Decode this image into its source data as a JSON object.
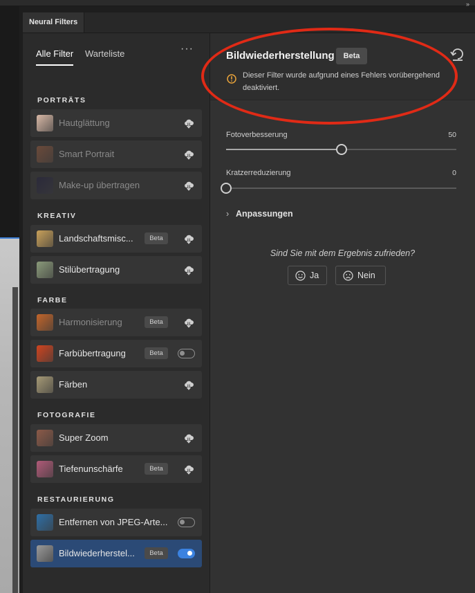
{
  "window": {
    "collapse_label": "»"
  },
  "panel": {
    "tab_label": "Neural Filters"
  },
  "filter_tabs": {
    "all": "Alle Filter",
    "waitlist": "Warteliste",
    "more": "···"
  },
  "sections": [
    {
      "title": "PORTRÄTS",
      "items": [
        {
          "label": "Hautglättung",
          "enabled": false,
          "beta": "",
          "action": "download",
          "thumb": "#d8b8a6"
        },
        {
          "label": "Smart Portrait",
          "enabled": false,
          "beta": "",
          "action": "download",
          "thumb": "#6a4a3a"
        },
        {
          "label": "Make-up übertragen",
          "enabled": false,
          "beta": "",
          "action": "download",
          "thumb": "#2b2a3a"
        }
      ]
    },
    {
      "title": "KREATIV",
      "items": [
        {
          "label": "Landschaftsmisc...",
          "enabled": true,
          "beta": "Beta",
          "action": "download",
          "thumb": "#c9a15a"
        },
        {
          "label": "Stilübertragung",
          "enabled": true,
          "beta": "",
          "action": "download",
          "thumb": "#8a9a7a"
        }
      ]
    },
    {
      "title": "FARBE",
      "items": [
        {
          "label": "Harmonisierung",
          "enabled": false,
          "beta": "Beta",
          "action": "download",
          "thumb": "#c2652a"
        },
        {
          "label": "Farbübertragung",
          "enabled": true,
          "beta": "Beta",
          "action": "toggle-off",
          "thumb": "#d0441f"
        },
        {
          "label": "Färben",
          "enabled": true,
          "beta": "",
          "action": "download",
          "thumb": "#a69a76"
        }
      ]
    },
    {
      "title": "FOTOGRAFIE",
      "items": [
        {
          "label": "Super Zoom",
          "enabled": true,
          "beta": "",
          "action": "download",
          "thumb": "#8c5a48"
        },
        {
          "label": "Tiefenunschärfe",
          "enabled": true,
          "beta": "Beta",
          "action": "download",
          "thumb": "#b05a78"
        }
      ]
    },
    {
      "title": "RESTAURIERUNG",
      "items": [
        {
          "label": "Entfernen von JPEG-Arte...",
          "enabled": true,
          "beta": "",
          "action": "toggle-off",
          "thumb": "#2e6fa6"
        },
        {
          "label": "Bildwiederherstel...",
          "enabled": true,
          "beta": "Beta",
          "action": "toggle-on",
          "thumb": "#9a9a9a",
          "selected": true
        }
      ]
    }
  ],
  "detail": {
    "title": "Bildwiederherstellung",
    "beta": "Beta",
    "warning": "Dieser Filter wurde aufgrund eines Fehlers vorübergehend deaktiviert.",
    "sliders": [
      {
        "label": "Fotoverbesserung",
        "value": 50,
        "min": 0,
        "max": 100
      },
      {
        "label": "Kratzerreduzierung",
        "value": 0,
        "min": 0,
        "max": 100
      }
    ],
    "adjustments_label": "Anpassungen",
    "feedback_question": "Sind Sie mit dem Ergebnis zufrieden?",
    "yes_label": "Ja",
    "no_label": "Nein"
  },
  "colors": {
    "accent_blue": "#3b82e0",
    "annotation_red": "#e02a16",
    "warning_orange": "#e8a33a"
  }
}
